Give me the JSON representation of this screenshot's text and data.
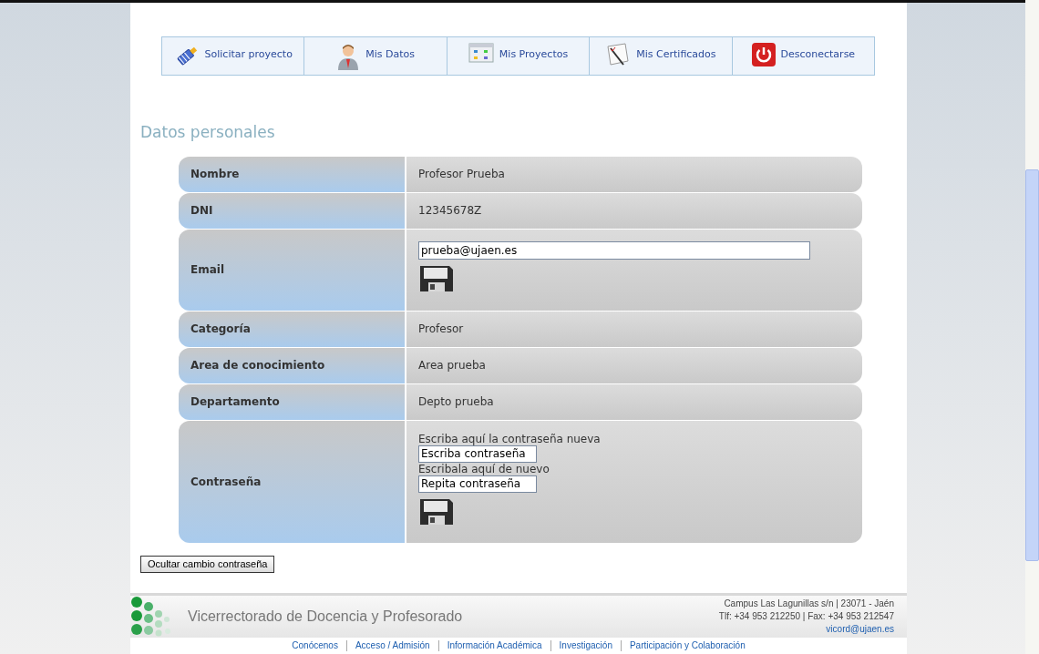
{
  "menu": [
    {
      "kind": "request",
      "label": "Solicitar proyecto"
    },
    {
      "kind": "profile",
      "label": "Mis Datos"
    },
    {
      "kind": "projects",
      "label": "Mis Proyectos"
    },
    {
      "kind": "certificates",
      "label": "Mis Certificados"
    },
    {
      "kind": "logout",
      "label": "Desconectarse"
    }
  ],
  "section_title": "Datos personales",
  "rows": [
    {
      "kind": "text",
      "label": "Nombre",
      "value": "Profesor Prueba"
    },
    {
      "kind": "text",
      "label": "DNI",
      "value": "12345678Z"
    },
    {
      "kind": "email",
      "label": "Email",
      "value": "prueba@ujaen.es"
    },
    {
      "kind": "text",
      "label": "Categoría",
      "value": "Profesor"
    },
    {
      "kind": "text",
      "label": "Area de conocimiento",
      "value": "Area prueba"
    },
    {
      "kind": "text",
      "label": "Departamento",
      "value": "Depto prueba"
    },
    {
      "kind": "password",
      "label": "Contraseña",
      "prompt": "Escriba aquí la contraseña nueva",
      "value": "Escriba contraseña",
      "repeat_prompt": "Escribala aquí de nuevo",
      "repeat_value": "Repita contraseña"
    }
  ],
  "toggle_button": "Ocultar cambio contraseña",
  "footer": {
    "title": "Vicerrectorado de Docencia y Profesorado",
    "address": "Campus Las Lagunillas s/n | 23071 - Jaén",
    "phone": "Tlf: +34 953 212250 | Fax: +34 953 212547",
    "email": "vicord@ujaen.es"
  },
  "links": [
    "Conócenos",
    "Acceso / Admisión",
    "Información Académica",
    "Investigación",
    "Participación y Colaboración"
  ]
}
